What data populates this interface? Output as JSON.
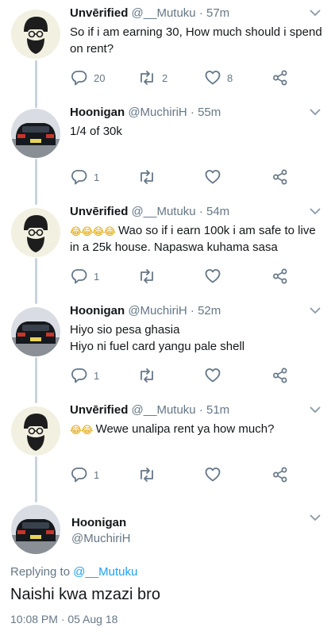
{
  "tweets": [
    {
      "name": "Unvērified",
      "handle": "@__Mutuku",
      "time": "· 57m",
      "text": "So if i am earning 30, How much should i spend on rent?",
      "replies": "20",
      "retweets": "2",
      "likes": "8"
    },
    {
      "name": "Hoonigan",
      "handle": "@MuchiriH",
      "time": "· 55m",
      "text": "1/4 of 30k",
      "replies": "1",
      "retweets": "",
      "likes": ""
    },
    {
      "name": "Unvērified",
      "handle": "@__Mutuku",
      "time": "· 54m",
      "emoji": "😂😂😂😂",
      "text": "Wao so if i earn 100k i am safe to live in a 25k house. Napaswa kuhama sasa",
      "replies": "1",
      "retweets": "",
      "likes": ""
    },
    {
      "name": "Hoonigan",
      "handle": "@MuchiriH",
      "time": "· 52m",
      "text_line1": "Hiyo sio pesa ghasia",
      "text_line2": "Hiyo ni fuel card yangu pale shell",
      "replies": "1",
      "retweets": "",
      "likes": ""
    },
    {
      "name": "Unvērified",
      "handle": "@__Mutuku",
      "time": "· 51m",
      "emoji": "😂😂",
      "text": "Wewe unalipa rent ya how much?",
      "replies": "1",
      "retweets": "",
      "likes": ""
    }
  ],
  "focus": {
    "name": "Hoonigan",
    "handle": "@MuchiriH",
    "replying_prefix": "Replying to",
    "replying_to": "@__Mutuku",
    "text": "Naishi kwa mzazi bro",
    "timestamp": "10:08 PM · 05 Aug 18"
  },
  "icons": {
    "reply": "reply-icon",
    "retweet": "retweet-icon",
    "like": "heart-icon",
    "share": "share-icon",
    "menu": "chevron-down-icon"
  },
  "colors": {
    "text": "#14171a",
    "muted": "#657786",
    "link": "#1da1f2",
    "thread": "#c9d3dc"
  }
}
